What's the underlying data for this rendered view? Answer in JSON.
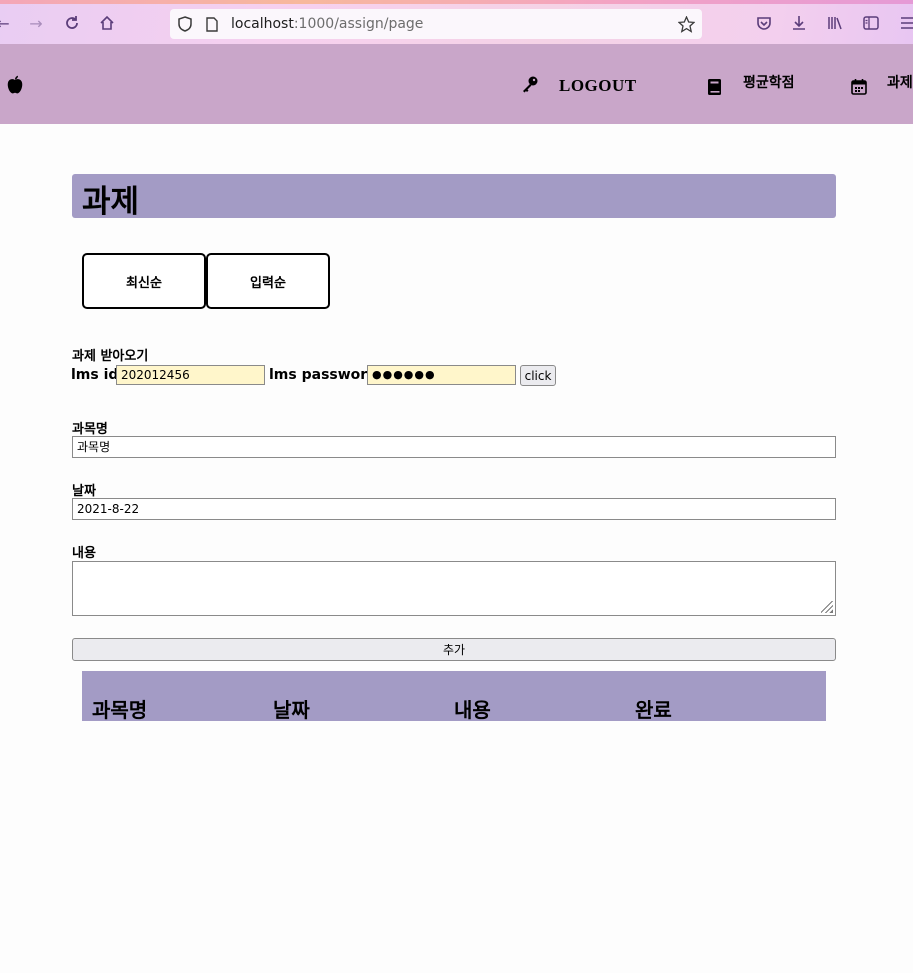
{
  "browser": {
    "url_host": "localhost",
    "url_path": ":1000/assign/page"
  },
  "header": {
    "logout_label": "LOGOUT",
    "gpa_label": "평균학점",
    "assign_label": "과제"
  },
  "page": {
    "title": "과제"
  },
  "sort": {
    "latest_label": "최신순",
    "input_order_label": "입력순"
  },
  "fetch": {
    "section_label": "과제 받아오기",
    "lms_id_label": "lms id",
    "lms_id_value": "202012456",
    "lms_password_label": "lms password",
    "lms_password_value": "●●●●●●",
    "click_label": "click"
  },
  "form": {
    "subject_label": "과목명",
    "subject_value": "과목명",
    "date_label": "날짜",
    "date_value": "2021-8-22",
    "content_label": "내용",
    "content_value": "",
    "add_label": "추가"
  },
  "table": {
    "columns": [
      "과목명",
      "날짜",
      "내용",
      "완료"
    ]
  },
  "colors": {
    "header_bg": "#c9a6c9",
    "accent": "#a39bc5",
    "input_autofill": "#fff6cb"
  }
}
